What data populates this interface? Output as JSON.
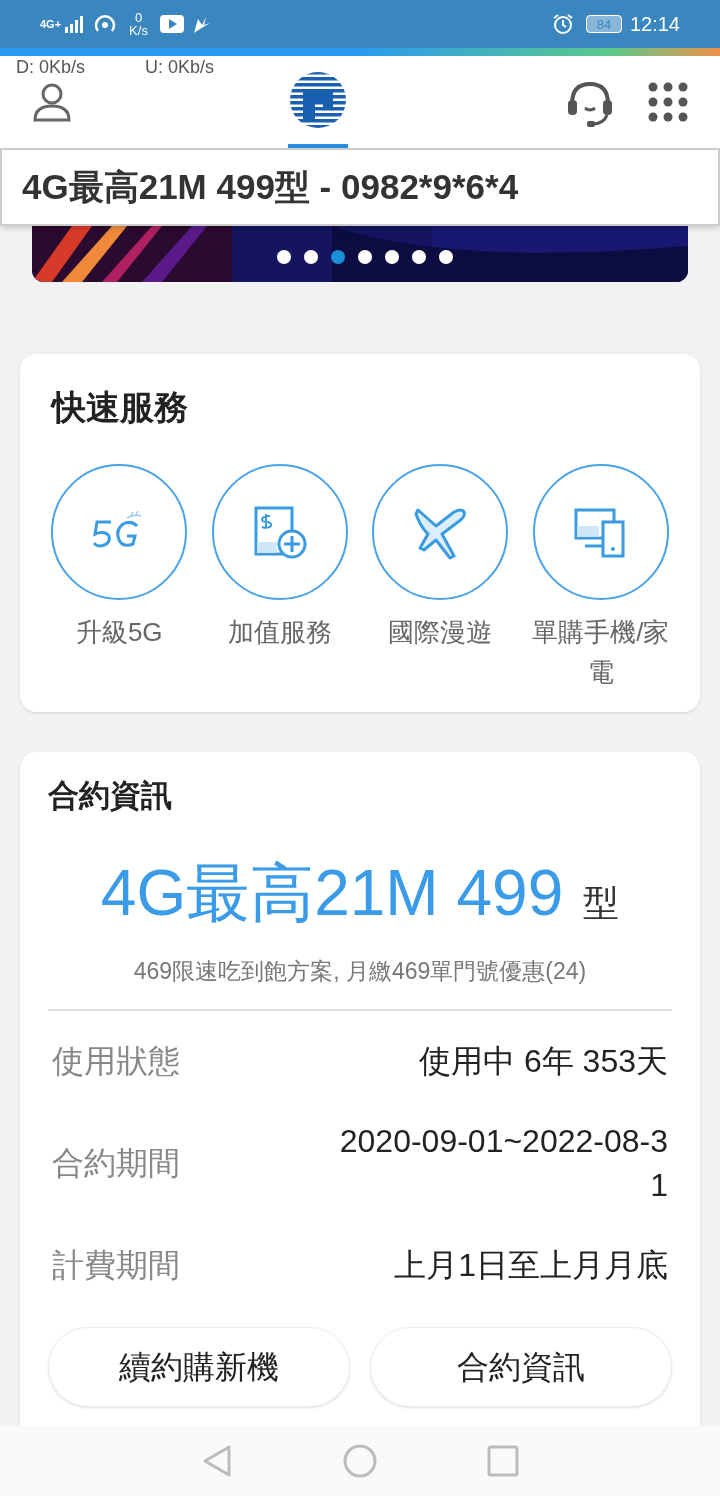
{
  "status_bar": {
    "network": "4G+",
    "speed_value": "0",
    "speed_unit": "K/s",
    "battery": "84",
    "time": "12:14"
  },
  "speed_overlay": {
    "download": "D: 0Kb/s",
    "upload": "U: 0Kb/s"
  },
  "header": {
    "logo_selected": true
  },
  "account_bar": {
    "title": "4G最高21M 499型 - 0982*9*6*4"
  },
  "banner": {
    "kind": "picture",
    "dots": [
      {
        "selected": false
      },
      {
        "selected": false
      },
      {
        "selected": true
      },
      {
        "selected": false
      },
      {
        "selected": false
      },
      {
        "selected": false
      },
      {
        "selected": false
      }
    ]
  },
  "quick_services": {
    "title": "快速服務",
    "items": [
      {
        "kind": "fiveg",
        "label": "升級5G"
      },
      {
        "kind": "addon",
        "label": "加值服務"
      },
      {
        "kind": "roaming",
        "label": "國際漫遊"
      },
      {
        "kind": "devices",
        "label": "單購手機/家電"
      }
    ]
  },
  "contract": {
    "title": "合約資訊",
    "plan_name": "4G最高21M 499",
    "plan_suffix": "型",
    "plan_desc": "469限速吃到飽方案, 月繳469單門號優惠(24)",
    "rows": [
      {
        "label": "使用狀態",
        "value": "使用中 6年 353天"
      },
      {
        "label": "合約期間",
        "value": "2020-09-01~2022-08-31"
      },
      {
        "label": "計費期間",
        "value": "上月1日至上月月底"
      }
    ],
    "buttons": [
      "續約購新機",
      "合約資訊"
    ]
  }
}
